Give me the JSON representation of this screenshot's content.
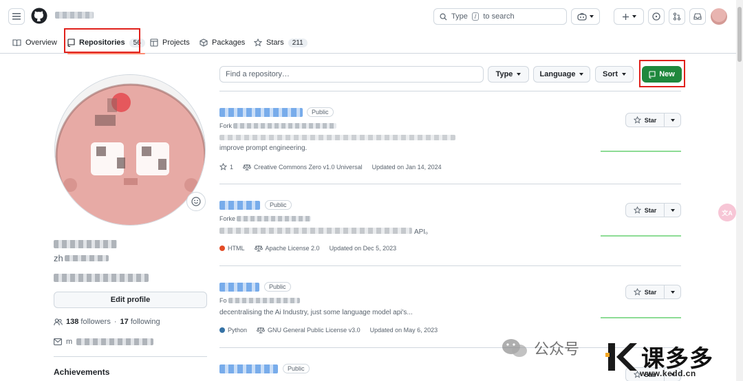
{
  "header": {
    "search_placeholder_prefix": "Type",
    "search_key": "/",
    "search_placeholder_suffix": "to search"
  },
  "tabs": [
    {
      "label": "Overview",
      "icon": "book-icon"
    },
    {
      "label": "Repositories",
      "count": "56",
      "icon": "repo-icon"
    },
    {
      "label": "Projects",
      "icon": "table-icon"
    },
    {
      "label": "Packages",
      "icon": "package-icon"
    },
    {
      "label": "Stars",
      "count": "211",
      "icon": "star-icon"
    }
  ],
  "profile": {
    "name_prefix": "zh",
    "edit_button": "Edit profile",
    "followers_count": "138",
    "followers_label": "followers",
    "following_count": "17",
    "following_label": "following",
    "email_prefix": "m",
    "achievements": "Achievements"
  },
  "filters": {
    "search_placeholder": "Find a repository…",
    "type": "Type",
    "language": "Language",
    "sort": "Sort",
    "new": "New"
  },
  "repos": [
    {
      "visibility": "Public",
      "forked_prefix": "Fork",
      "description": "improve prompt engineering.",
      "stars": "1",
      "license": "Creative Commons Zero v1.0 Universal",
      "updated": "Updated on Jan 14, 2024",
      "star_label": "Star"
    },
    {
      "visibility": "Public",
      "forked_prefix": "Forke",
      "description": "API。",
      "language": "HTML",
      "language_color": "#e34c26",
      "license": "Apache License 2.0",
      "updated": "Updated on Dec 5, 2023",
      "star_label": "Star"
    },
    {
      "visibility": "Public",
      "forked_prefix": "Fo",
      "description": "decentralising the Ai Industry, just some language model api's...",
      "language": "Python",
      "language_color": "#3572A5",
      "license": "GNU General Public License v3.0",
      "updated": "Updated on May 6, 2023",
      "star_label": "Star"
    },
    {
      "visibility": "Public",
      "star_label": "Star"
    }
  ],
  "watermark": {
    "account": "公众号",
    "brand": "课多多",
    "url": "www.kedd.cn"
  },
  "float_badge": "文A",
  "colors": {
    "accent_green": "#1f883d",
    "highlight_red": "#e0201b",
    "tab_underline": "#fd8c73",
    "link_blue": "#0969da"
  }
}
